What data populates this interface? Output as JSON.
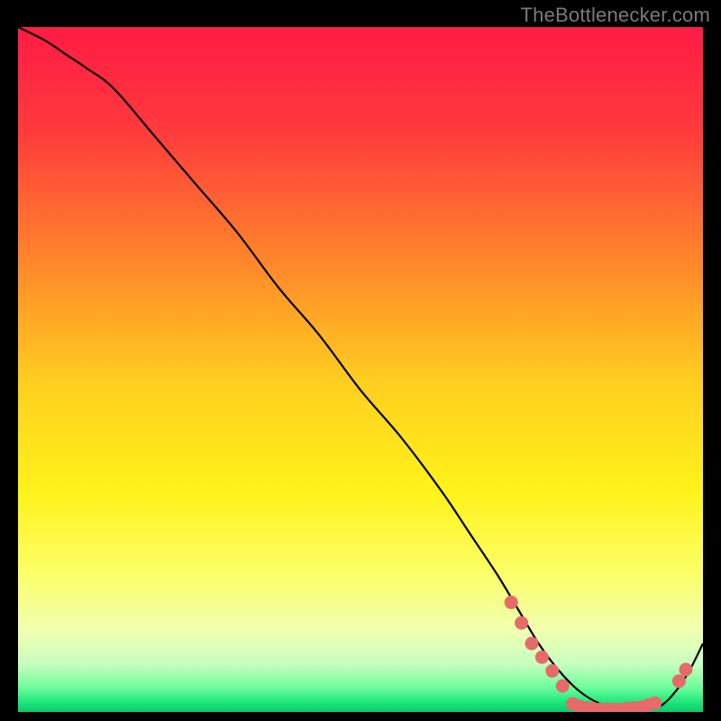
{
  "attribution": "TheBottlenecker.com",
  "colors": {
    "gradient_stops": [
      {
        "offset": 0.0,
        "color": "#ff1b44"
      },
      {
        "offset": 0.15,
        "color": "#ff3a3c"
      },
      {
        "offset": 0.35,
        "color": "#ff8a2a"
      },
      {
        "offset": 0.52,
        "color": "#ffcf1f"
      },
      {
        "offset": 0.68,
        "color": "#fff31a"
      },
      {
        "offset": 0.8,
        "color": "#fbff6a"
      },
      {
        "offset": 0.88,
        "color": "#f1ffb0"
      },
      {
        "offset": 0.93,
        "color": "#c8ffc0"
      },
      {
        "offset": 0.965,
        "color": "#6bfc9a"
      },
      {
        "offset": 0.985,
        "color": "#20e97c"
      },
      {
        "offset": 1.0,
        "color": "#0dc96f"
      }
    ],
    "curve": "#000000",
    "marker_fill": "#e66a6a",
    "marker_stroke": "#b94a4a"
  },
  "chart_data": {
    "type": "line",
    "title": "",
    "xlabel": "",
    "ylabel": "",
    "xlim": [
      0,
      100
    ],
    "ylim": [
      0,
      100
    ],
    "series": [
      {
        "name": "curve",
        "x": [
          0,
          4,
          7,
          10,
          14,
          20,
          26,
          32,
          38,
          44,
          50,
          56,
          62,
          66,
          70,
          73,
          76,
          79,
          82,
          85,
          88,
          90,
          92,
          94,
          96,
          98,
          100
        ],
        "y": [
          100,
          98,
          96,
          94,
          91,
          84,
          77,
          70,
          62,
          55,
          47,
          40,
          32,
          26,
          20,
          15,
          10,
          6,
          3,
          1.2,
          0.5,
          0.3,
          0.4,
          1.0,
          3.0,
          6.0,
          10
        ]
      }
    ],
    "markers": [
      {
        "x": 72,
        "y": 16
      },
      {
        "x": 73.5,
        "y": 13
      },
      {
        "x": 75,
        "y": 10
      },
      {
        "x": 76.5,
        "y": 8
      },
      {
        "x": 78,
        "y": 6
      },
      {
        "x": 79.5,
        "y": 3.8
      },
      {
        "x": 81,
        "y": 1.2
      },
      {
        "x": 82,
        "y": 0.8
      },
      {
        "x": 83,
        "y": 0.6
      },
      {
        "x": 84,
        "y": 0.5
      },
      {
        "x": 85,
        "y": 0.4
      },
      {
        "x": 86,
        "y": 0.4
      },
      {
        "x": 87,
        "y": 0.4
      },
      {
        "x": 88,
        "y": 0.4
      },
      {
        "x": 89,
        "y": 0.5
      },
      {
        "x": 90,
        "y": 0.6
      },
      {
        "x": 91,
        "y": 0.7
      },
      {
        "x": 92,
        "y": 1.0
      },
      {
        "x": 93,
        "y": 1.3
      },
      {
        "x": 96.5,
        "y": 4.5
      },
      {
        "x": 97.5,
        "y": 6.2
      }
    ]
  }
}
